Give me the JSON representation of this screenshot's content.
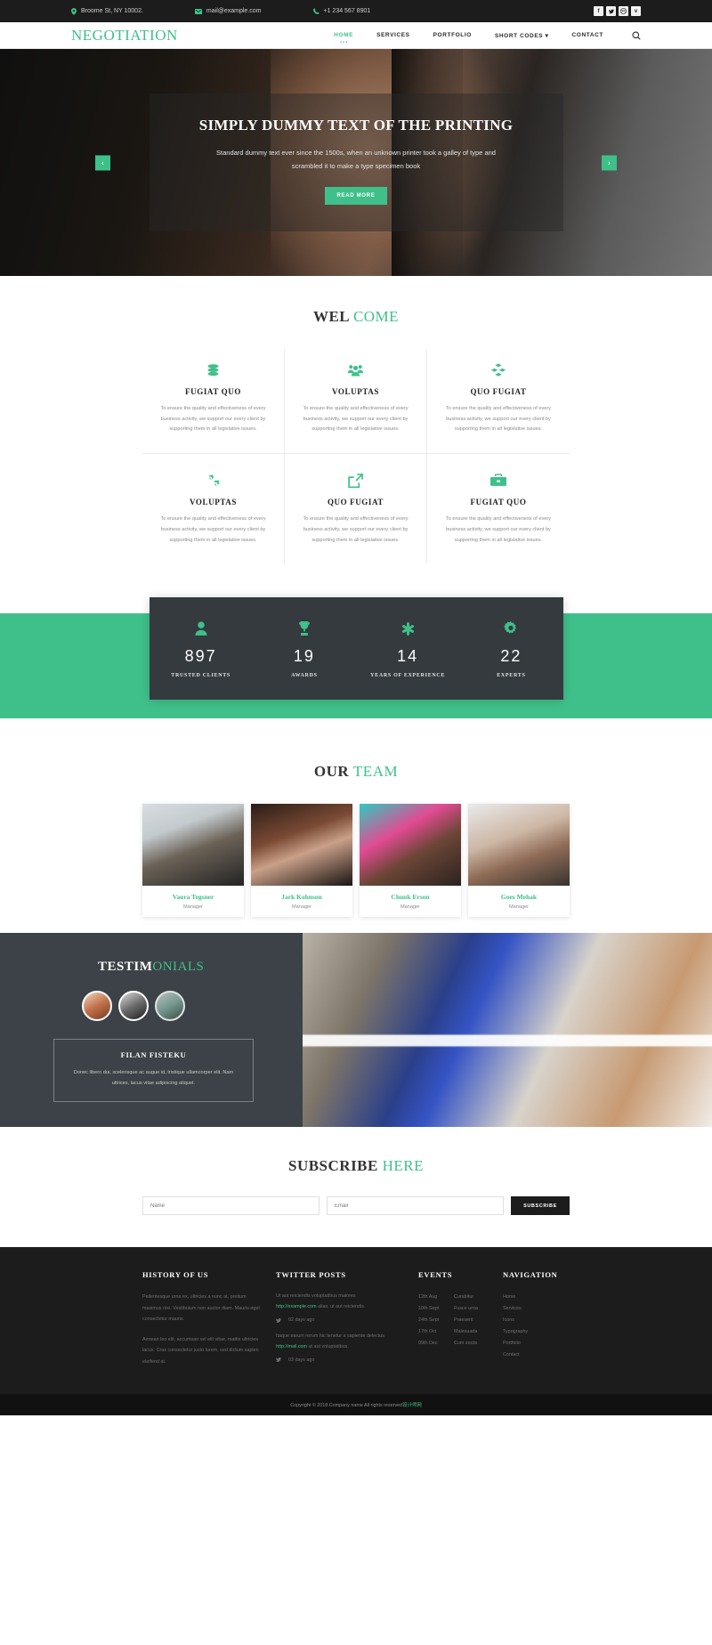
{
  "topbar": {
    "address": "Broome St, NY 10002.",
    "email": "mail@example.com",
    "phone": "+1 234 567 8901",
    "socials": [
      {
        "name": "facebook-icon",
        "glyph": "f"
      },
      {
        "name": "twitter-icon",
        "glyph": "✒"
      },
      {
        "name": "dribbble-icon",
        "glyph": "◎"
      },
      {
        "name": "vimeo-icon",
        "glyph": "v"
      }
    ]
  },
  "header": {
    "logo": "NEGOTIATION",
    "nav": [
      {
        "label": "HOME",
        "active": true
      },
      {
        "label": "SERVICES",
        "active": false
      },
      {
        "label": "PORTFOLIO",
        "active": false
      },
      {
        "label": "SHORT CODES ▾",
        "active": false
      },
      {
        "label": "CONTACT",
        "active": false
      }
    ],
    "search_icon": "search-icon"
  },
  "hero": {
    "title": "SIMPLY DUMMY TEXT OF THE PRINTING",
    "subtitle": "Standard dummy text ever since the 1500s, when an unknown printer took a galley of type and scrambled it to make a type specimen book",
    "cta": "READ MORE",
    "prev": "‹",
    "next": "›"
  },
  "welcome": {
    "title_bold": "WEL",
    "title_accent": "COME",
    "body": "To ensure the quality and effectiveness of every business activity, we support our every client by supporting them in all legislative issues.",
    "cards": [
      {
        "icon": "database-icon",
        "title": "FUGIAT QUO"
      },
      {
        "icon": "users-group-icon",
        "title": "VOLUPTAS"
      },
      {
        "icon": "cubes-icon",
        "title": "QUO FUGIAT"
      },
      {
        "icon": "cogs-icon",
        "title": "VOLUPTAS"
      },
      {
        "icon": "external-link-icon",
        "title": "QUO FUGIAT"
      },
      {
        "icon": "briefcase-icon",
        "title": "FUGIAT QUO"
      }
    ]
  },
  "stats": [
    {
      "icon": "user-icon",
      "value": "897",
      "label": "TRUSTED CLIENTS"
    },
    {
      "icon": "trophy-icon",
      "value": "19",
      "label": "AWARDS"
    },
    {
      "icon": "asterisk-icon",
      "value": "14",
      "label": "YEARS OF EXPERIENCE"
    },
    {
      "icon": "gear-icon",
      "value": "22",
      "label": "EXPERTS"
    }
  ],
  "team": {
    "title_bold": "OUR",
    "title_accent": "TEAM",
    "members": [
      {
        "name": "Vaura Tegsner",
        "role": "Manager"
      },
      {
        "name": "Jark Kohnson",
        "role": "Manager"
      },
      {
        "name": "Chunk Erson",
        "role": "Manager"
      },
      {
        "name": "Goes Mehak",
        "role": "Manager"
      }
    ]
  },
  "testimonials": {
    "title_bold": "TESTIM",
    "title_accent": "ONIALS",
    "author": "FILAN FISTEKU",
    "text": "Donec libero dui, scelerisque ac augue id, tristique ullamcorper elit. Nam ultrices, lacus vitae adipiscing aliquet."
  },
  "subscribe": {
    "title_bold": "SUBSCRIBE",
    "title_accent": "HERE",
    "name_placeholder": "Name",
    "email_placeholder": "Email",
    "button": "SUBSCRIBE"
  },
  "footer": {
    "history": {
      "title": "HISTORY OF US",
      "p1": "Pellentesque urna ex, ultricies a nunc at, pretium maximus nisi. Vestibulum non auctor diam. Mauris eget consectetur mauris.",
      "p2": "Aenean leo elit, accumsan vel elit vitae, mattis ultricies lacus. Cras consectetur justo lorem, sed dictum sapien eleifend at."
    },
    "twitter": {
      "title": "TWITTER POSTS",
      "posts": [
        {
          "text": "Ut aut reiciendis voluptatibus maiores",
          "link": "http://example.com",
          "tail": "alias, ut aut reiciendis.",
          "time": "02 days ago"
        },
        {
          "text": "Itaque earum rerum hic tenetur a sapiente delectus",
          "link": "http://mail.com",
          "tail": "ut aut voluptatibus.",
          "time": "03 days ago"
        }
      ]
    },
    "events": {
      "title": "EVENTS",
      "items": [
        {
          "date": "12th Aug",
          "name": "Curabitur"
        },
        {
          "date": "10th Sept",
          "name": "Fusce urna"
        },
        {
          "date": "24th Sept",
          "name": "Praesent"
        },
        {
          "date": "17th Oct",
          "name": "Malesuada"
        },
        {
          "date": "09th Dec",
          "name": "Cum sociis"
        }
      ]
    },
    "navigation": {
      "title": "NAVIGATION",
      "items": [
        "Home",
        "Services",
        "Icons",
        "Typography",
        "Portfolio",
        "Contact"
      ]
    },
    "copyright_before": "Copyright © 2018.Company name All rights reserved",
    "copyright_accent": "设计师网"
  }
}
